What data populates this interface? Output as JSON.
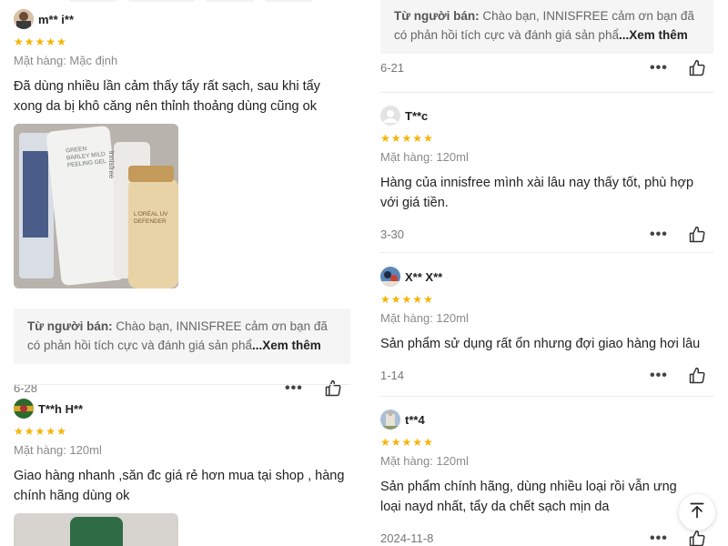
{
  "left": {
    "reviews": [
      {
        "username": "m** i**",
        "stars": 5,
        "variant": "Mặt hàng: Mặc định",
        "text": "Đã dùng nhiều lần cảm thấy tẩy rất sạch, sau khi tẩy xong da bị khô căng nên thỉnh thoảng dùng cũng ok",
        "photo_caption_1": "GREEN BARLEY MILD PEELING GEL",
        "photo_caption_2": "innisfree",
        "photo_caption_3": "L'ORÉAL UV DEFENDER",
        "seller_label": "Từ người bán:",
        "seller_text": "Chào bạn, INNISFREE cảm ơn bạn đã có phản hồi tích cực và đánh giá sản phẩ",
        "seller_more": "...Xem thêm",
        "date": "6-28"
      },
      {
        "username": "T**h H**",
        "stars": 5,
        "variant": "Mặt hàng: 120ml",
        "text": "Giao hàng nhanh ,săn đc giá rẻ hơn mua tại shop , hàng chính hãng dùng ok"
      }
    ]
  },
  "right": {
    "seller_reply_top": {
      "seller_label": "Từ người bán:",
      "seller_text": "Chào bạn, INNISFREE cảm ơn bạn đã có phản hồi tích cực và đánh giá sản phẩ",
      "seller_more": "...Xem thêm",
      "date": "6-21"
    },
    "reviews": [
      {
        "username": "T**c",
        "stars": 5,
        "variant": "Mặt hàng: 120ml",
        "text": "Hàng của innisfree mình xài lâu nay thấy tốt, phù hợp với giá tiền.",
        "date": "3-30"
      },
      {
        "username": "X** X**",
        "stars": 5,
        "variant": "Mặt hàng: 120ml",
        "text": "Sản phẩm sử dụng rất ổn nhưng đợi giao hàng hơi lâu",
        "date": "1-14"
      },
      {
        "username": "t**4",
        "stars": 5,
        "variant": "Mặt hàng: 120ml",
        "text": "Sản phẩm chính hãng, dùng nhiều loại rồi vẫn ưng loại nayd nhất, tẩy da chết sạch mịn da",
        "date": "2024-11-8"
      }
    ]
  },
  "colors": {
    "star": "#f5b400",
    "seller_bg": "#f5f5f5",
    "muted_text": "#8a8a8a"
  },
  "icons": {
    "more": "more-dots-icon",
    "like": "thumbs-up-icon",
    "star": "star-icon",
    "back_to_top": "arrow-up-to-top-icon"
  }
}
